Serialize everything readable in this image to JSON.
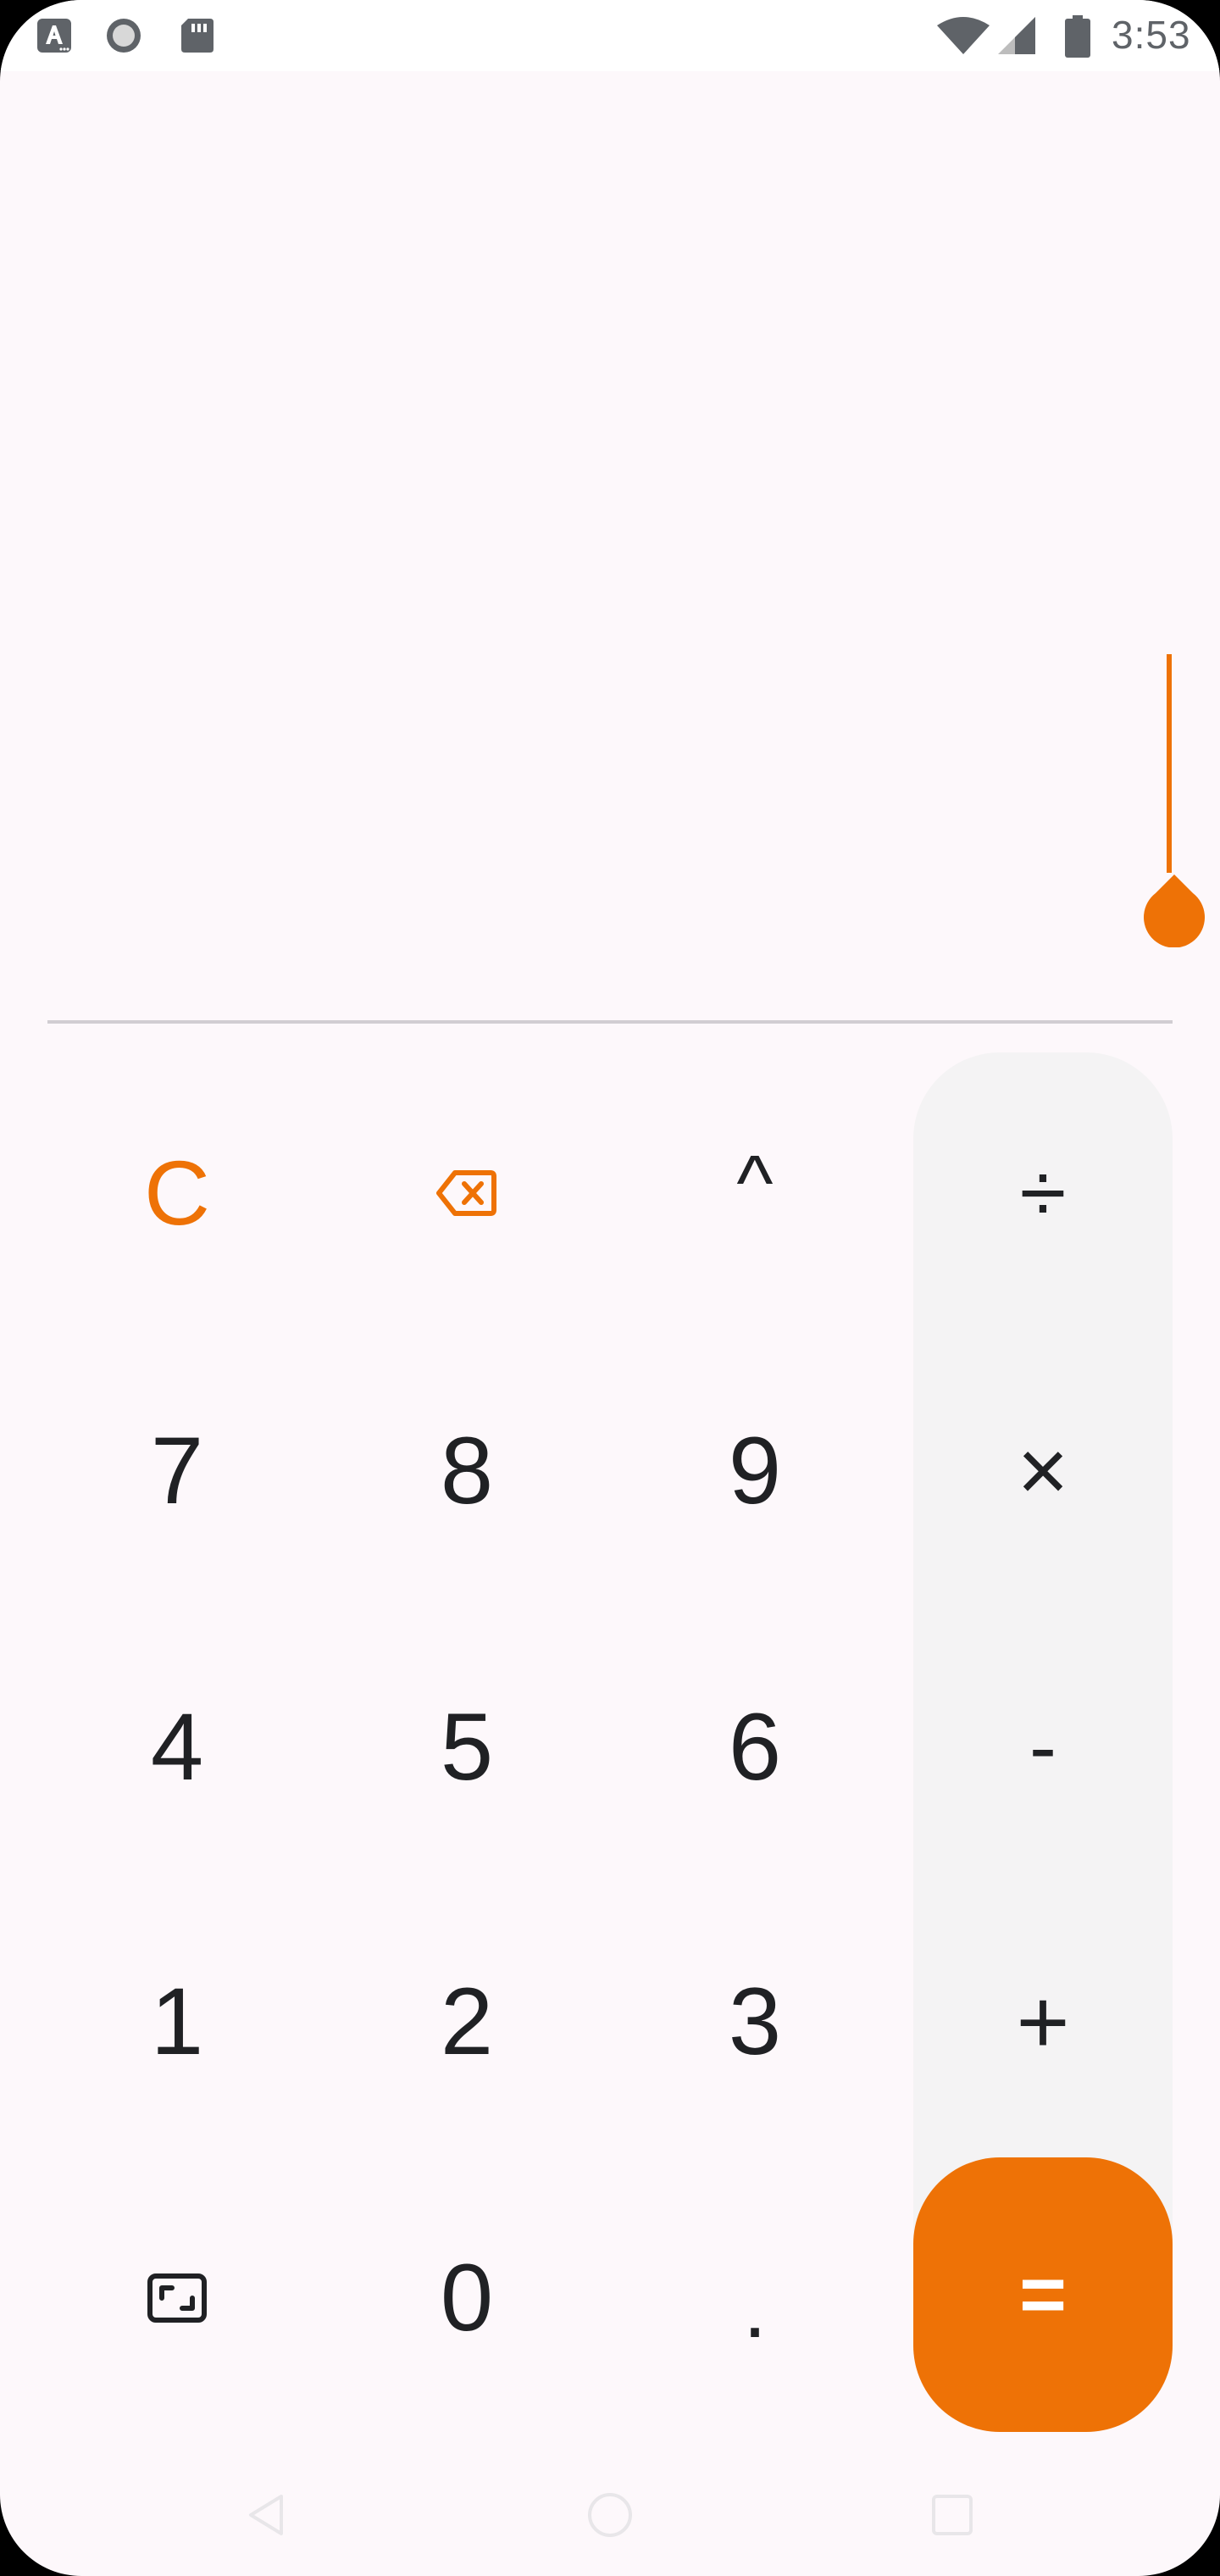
{
  "status_bar": {
    "time": "3:53",
    "left_icons": [
      "text-a-icon",
      "record-circle-icon",
      "sd-card-icon"
    ],
    "right_icons": [
      "wifi-icon",
      "signal-icon",
      "battery-icon"
    ]
  },
  "display": {
    "expression": "",
    "result": ""
  },
  "keypad": {
    "clear": "C",
    "power": "^",
    "divide": "÷",
    "multiply": "×",
    "minus": "-",
    "plus": "+",
    "equals": "=",
    "seven": "7",
    "eight": "8",
    "nine": "9",
    "four": "4",
    "five": "5",
    "six": "6",
    "one": "1",
    "two": "2",
    "three": "3",
    "zero": "0",
    "decimal": "."
  },
  "colors": {
    "accent": "#EE7206",
    "background": "#FDF8FB",
    "operator_column": "#F4F3F4",
    "text": "#202124"
  },
  "navigation": {
    "icons": [
      "back-icon",
      "home-icon",
      "recents-icon"
    ]
  }
}
